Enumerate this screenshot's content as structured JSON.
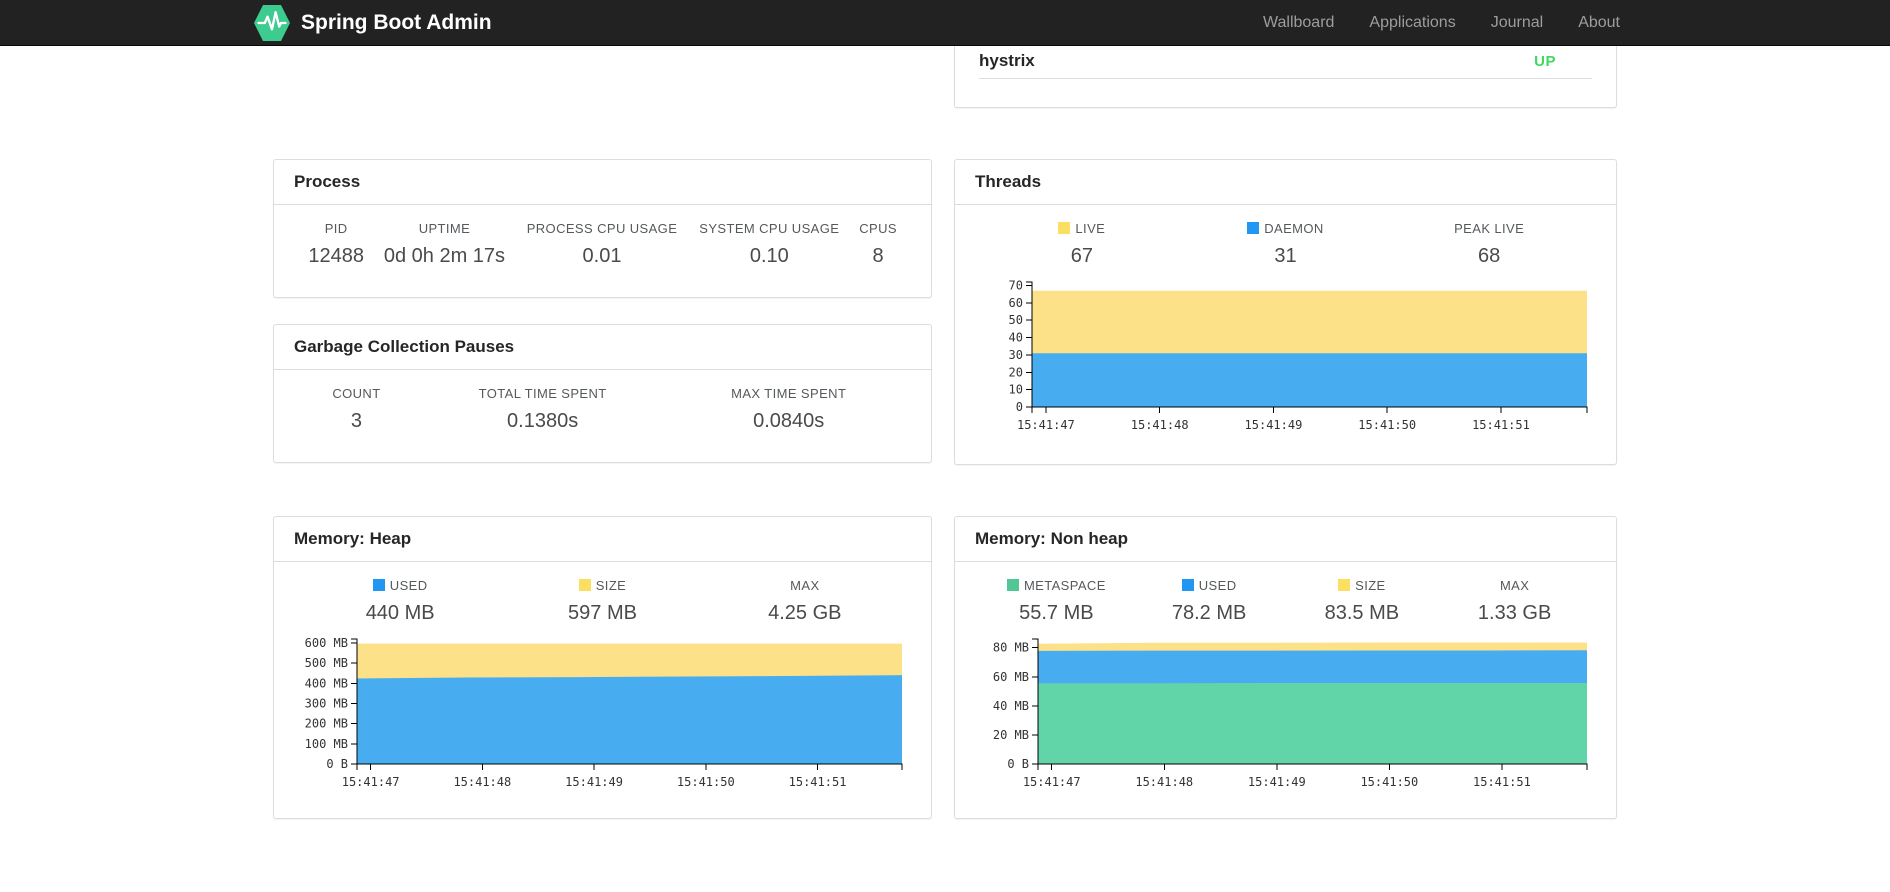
{
  "navbar": {
    "brand": "Spring Boot Admin",
    "brand_color": "#3ecb90",
    "links": [
      {
        "label": "Wallboard"
      },
      {
        "label": "Applications"
      },
      {
        "label": "Journal"
      },
      {
        "label": "About"
      }
    ]
  },
  "health_panel": {
    "rows": [
      {
        "name": "hystrix",
        "status": "UP",
        "status_color": "#40d861"
      }
    ]
  },
  "panels": {
    "process": {
      "title": "Process",
      "stats": [
        {
          "label": "PID",
          "value": "12488"
        },
        {
          "label": "UPTIME",
          "value": "0d 0h 2m 17s"
        },
        {
          "label": "PROCESS CPU USAGE",
          "value": "0.01"
        },
        {
          "label": "SYSTEM CPU USAGE",
          "value": "0.10"
        },
        {
          "label": "CPUS",
          "value": "8"
        }
      ]
    },
    "gc": {
      "title": "Garbage Collection Pauses",
      "stats": [
        {
          "label": "COUNT",
          "value": "3"
        },
        {
          "label": "TOTAL TIME SPENT",
          "value": "0.1380s"
        },
        {
          "label": "MAX TIME SPENT",
          "value": "0.0840s"
        }
      ]
    },
    "threads": {
      "title": "Threads",
      "stats": [
        {
          "label": "LIVE",
          "value": "67",
          "color": "#fcdf61"
        },
        {
          "label": "DAEMON",
          "value": "31",
          "color": "#2196f3"
        },
        {
          "label": "PEAK LIVE",
          "value": "68"
        }
      ],
      "chart": {
        "type": "area",
        "x_tick_labels": [
          "15:41:47",
          "15:41:48",
          "15:41:49",
          "15:41:50",
          "15:41:51"
        ],
        "x_tick_fracs": [
          0.025,
          0.23,
          0.435,
          0.64,
          0.845
        ],
        "points_f": [
          0,
          0.2,
          0.41,
          0.61,
          0.82,
          1
        ],
        "y_tick_labels": [
          "0",
          "10",
          "20",
          "30",
          "40",
          "50",
          "60",
          "70"
        ],
        "y_tick_values": [
          0,
          10,
          20,
          30,
          40,
          50,
          60,
          70
        ],
        "y_max": 72,
        "series": [
          {
            "name": "LIVE",
            "color": "#fce189",
            "values": [
              67,
              67,
              67,
              67,
              67,
              67
            ]
          },
          {
            "name": "DAEMON",
            "color": "#48acf1",
            "values": [
              31,
              31,
              31,
              31,
              31,
              31
            ]
          }
        ]
      }
    },
    "memory_heap": {
      "title": "Memory: Heap",
      "stats": [
        {
          "label": "USED",
          "value": "440 MB",
          "color": "#2196f3"
        },
        {
          "label": "SIZE",
          "value": "597 MB",
          "color": "#fcdf61"
        },
        {
          "label": "MAX",
          "value": "4.25 GB"
        }
      ],
      "chart": {
        "type": "area",
        "x_tick_labels": [
          "15:41:47",
          "15:41:48",
          "15:41:49",
          "15:41:50",
          "15:41:51"
        ],
        "x_tick_fracs": [
          0.025,
          0.23,
          0.435,
          0.64,
          0.845
        ],
        "points_f": [
          0,
          0.2,
          0.41,
          0.61,
          0.82,
          1
        ],
        "y_tick_labels": [
          "0 B",
          "100 MB",
          "200 MB",
          "300 MB",
          "400 MB",
          "500 MB",
          "600 MB"
        ],
        "y_tick_values": [
          0,
          100,
          200,
          300,
          400,
          500,
          600
        ],
        "y_max": 620,
        "series": [
          {
            "name": "SIZE",
            "color": "#fce189",
            "values": [
              597,
              597,
              597,
              597,
              597,
              597
            ]
          },
          {
            "name": "USED",
            "color": "#48acf1",
            "values": [
              424,
              429,
              431,
              434,
              437,
              441
            ]
          }
        ]
      }
    },
    "memory_nonheap": {
      "title": "Memory: Non heap",
      "stats": [
        {
          "label": "METASPACE",
          "value": "55.7 MB",
          "color": "#52c796"
        },
        {
          "label": "USED",
          "value": "78.2 MB",
          "color": "#2196f3"
        },
        {
          "label": "SIZE",
          "value": "83.5 MB",
          "color": "#fcdf61"
        },
        {
          "label": "MAX",
          "value": "1.33 GB"
        }
      ],
      "chart": {
        "type": "area",
        "x_tick_labels": [
          "15:41:47",
          "15:41:48",
          "15:41:49",
          "15:41:50",
          "15:41:51"
        ],
        "x_tick_fracs": [
          0.025,
          0.23,
          0.435,
          0.64,
          0.845
        ],
        "points_f": [
          0,
          0.2,
          0.41,
          0.61,
          0.82,
          1
        ],
        "y_tick_labels": [
          "0 B",
          "20 MB",
          "40 MB",
          "60 MB",
          "80 MB"
        ],
        "y_tick_values": [
          0,
          20,
          40,
          60,
          80
        ],
        "y_max": 86,
        "series": [
          {
            "name": "SIZE",
            "color": "#fce189",
            "values": [
              82.8,
              83.4,
              83.4,
              83.6,
              83.6,
              83.6
            ]
          },
          {
            "name": "USED",
            "color": "#48acf1",
            "values": [
              77.8,
              78.0,
              78.0,
              78.1,
              78.1,
              78.2
            ]
          },
          {
            "name": "METASPACE",
            "color": "#61d5a7",
            "values": [
              55.6,
              55.6,
              55.7,
              55.7,
              55.7,
              55.7
            ]
          }
        ]
      }
    }
  }
}
